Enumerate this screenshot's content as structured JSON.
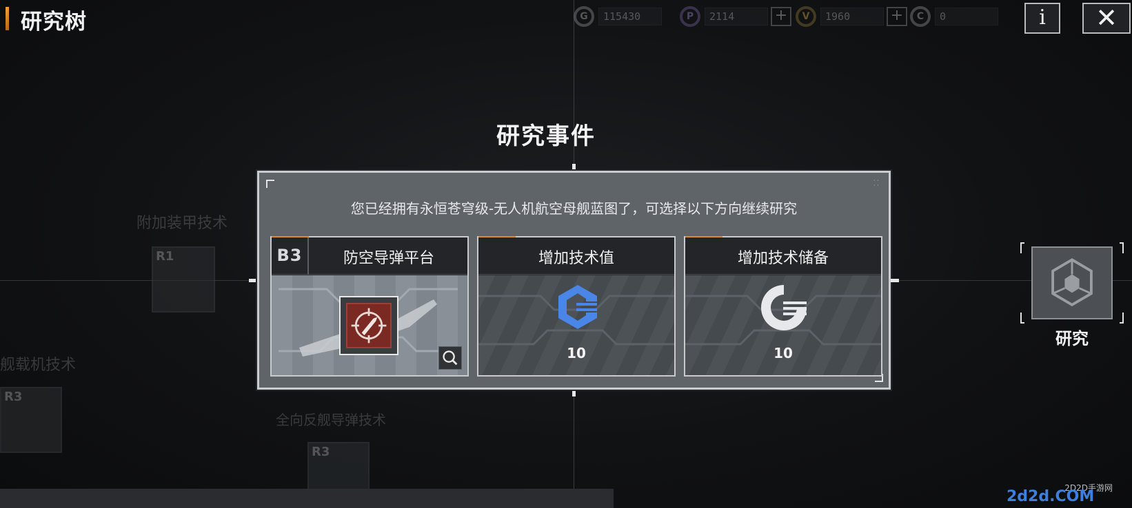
{
  "header": {
    "title": "研究树",
    "resources": [
      {
        "icon": "gear-currency-icon",
        "value": "115430",
        "has_plus": false
      },
      {
        "icon": "p-currency-icon",
        "value": "2114",
        "has_plus": true
      },
      {
        "icon": "v-currency-icon",
        "value": "1960",
        "has_plus": true
      },
      {
        "icon": "tech-reserve-icon",
        "value": "0",
        "has_plus": false
      }
    ],
    "info_label": "i",
    "close_label": "✕"
  },
  "background_tree": {
    "node_a_label": "附加装甲技术",
    "node_a_tier": "R1",
    "node_b_label": "舰载机技术",
    "node_b_tier": "R3",
    "node_c_label": "全向反舰导弹技术",
    "node_c_tier": "R3"
  },
  "dialog": {
    "title": "研究事件",
    "message": "您已经拥有永恒苍穹级-无人机航空母舰蓝图了，可选择以下方向继续研究",
    "cards": [
      {
        "tier": "B3",
        "title": "防空导弹平台",
        "value": ""
      },
      {
        "tier": "",
        "title": "增加技术值",
        "value": "10"
      },
      {
        "tier": "",
        "title": "增加技术储备",
        "value": "10"
      }
    ]
  },
  "research_node": {
    "label": "研究"
  },
  "watermark": {
    "site": "2D2D手游网",
    "domain": "2d2d.COM"
  },
  "colors": {
    "accent_orange": "#e08a22",
    "tech_value_blue": "#4a86e8",
    "dialog_bg": "#5f6469"
  }
}
